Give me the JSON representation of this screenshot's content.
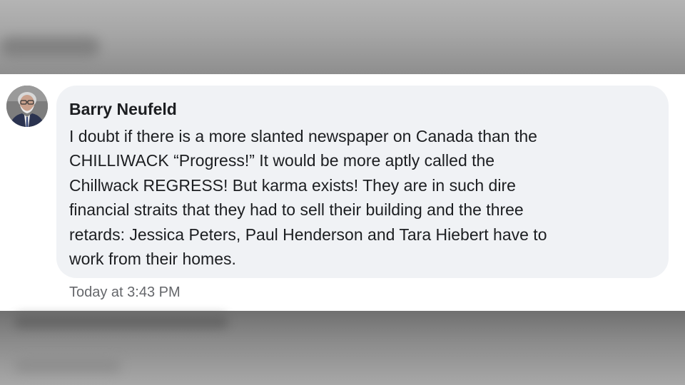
{
  "comment": {
    "author": "Barry Neufeld",
    "text_lines": [
      "I doubt if there is a more slanted newspaper on Canada than the",
      "CHILLIWACK “Progress!” It would be more aptly called the",
      "Chillwack REGRESS! But karma exists! They are in such dire",
      "financial straits that they had to sell their building and the three",
      "retards: Jessica Peters, Paul Henderson and Tara Hiebert have to",
      "work from their homes."
    ],
    "timestamp": "Today at 3:43 PM",
    "avatar_icon": "profile-photo-icon"
  },
  "colors": {
    "bubble": "#f0f2f5",
    "text": "#1c1e21",
    "timestamp": "#65676b",
    "panel": "#ffffff"
  }
}
